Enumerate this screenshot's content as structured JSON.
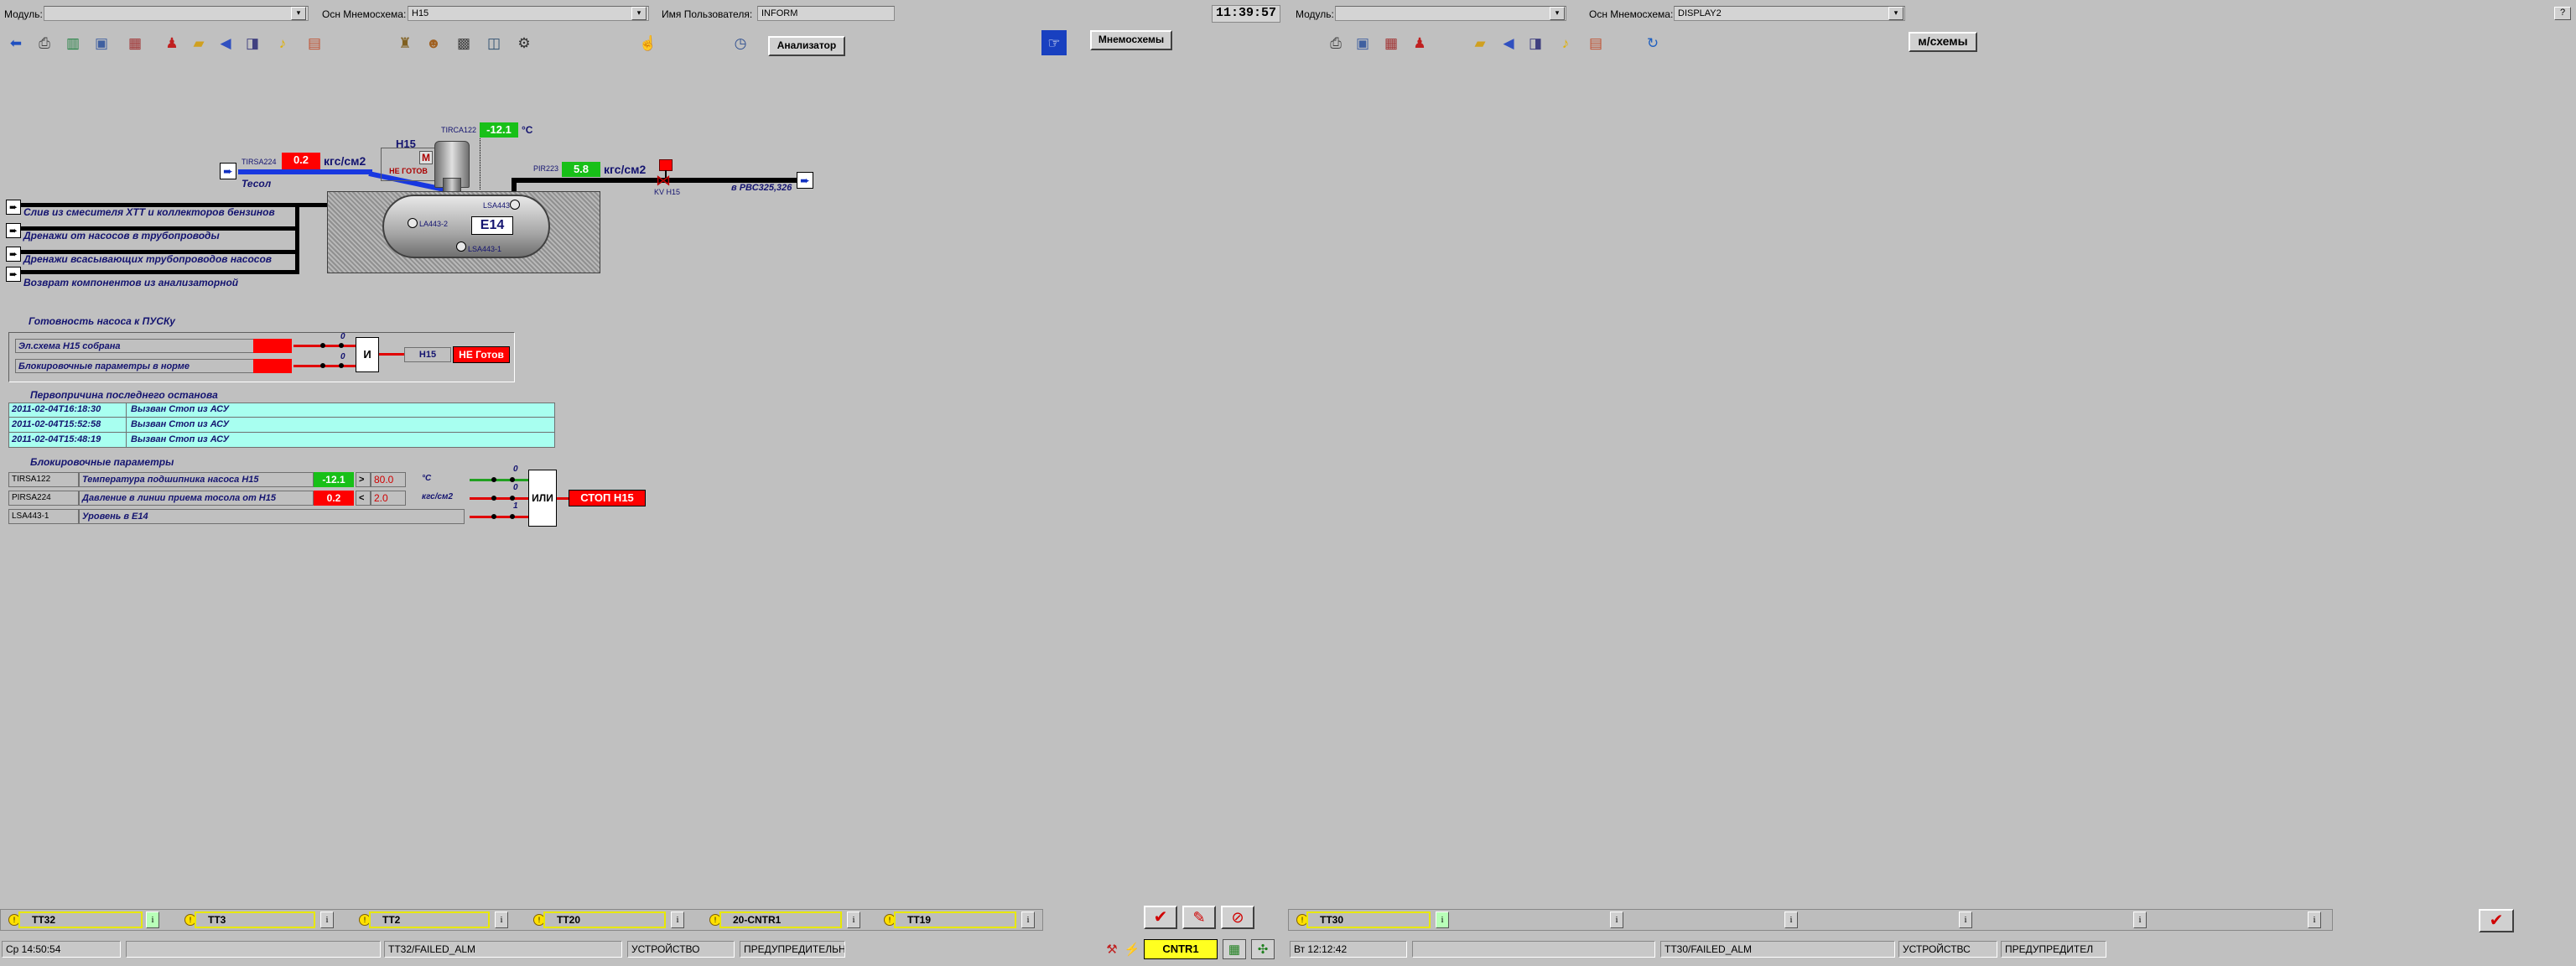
{
  "left_header": {
    "module_label": "Модуль:",
    "module_value": "",
    "mnemo_label": "Осн Мнемосхема:",
    "mnemo_value": "H15",
    "user_label": "Имя Пользователя:",
    "user_value": "INFORM"
  },
  "clock": "11:39:57",
  "right_header": {
    "module_label": "Модуль:",
    "module_value": "",
    "mnemo_label": "Осн Мнемосхема:",
    "mnemo_value": "DISPLAY2",
    "help": "?"
  },
  "buttons": {
    "analyzer": "Анализатор",
    "mnemoschemes": "Мнемосхемы",
    "mschemes_short": "м/схемы"
  },
  "schematic": {
    "tir_tag": "TIRSA224",
    "tir_value": "0.2",
    "tir_unit": "кгс/см2",
    "tesol": "Тесол",
    "pump_name": "H15",
    "pump_mode": "М",
    "pump_status": "НЕ ГОТОВ",
    "temp_tag": "TIRCA122",
    "temp_value": "-12.1",
    "temp_unit": "°C",
    "pir_tag": "PIR223",
    "pir_value": "5.8",
    "pir_unit": "кгс/см2",
    "kv_tag": "KV H15",
    "dest": "в РВС325,326",
    "tank_name": "E14",
    "lsa_2": "LA443-2",
    "lsa_4": "LSA443",
    "lsa_1": "LSA443-1",
    "inlets": [
      "Слив из смесителя ХТТ и коллекторов бензинов",
      "Дренажи от насосов в трубопроводы",
      "Дренажи всасывающих трубопроводов насосов",
      "Возврат компонентов из анализаторной"
    ]
  },
  "readiness": {
    "title": "Готовность насоса к ПУСКу",
    "rows": [
      "Эл.схема H15 собрана",
      "Блокировочные параметры в норме"
    ],
    "gate": "И",
    "zero": "0",
    "pump": "H15",
    "status": "НЕ Готов"
  },
  "first_cause": {
    "title": "Первопричина последнего останова",
    "rows": [
      {
        "time": "2011-02-04T16:18:30",
        "msg": "Вызван Стоп из АСУ"
      },
      {
        "time": "2011-02-04T15:52:58",
        "msg": "Вызван Стоп из АСУ"
      },
      {
        "time": "2011-02-04T15:48:19",
        "msg": "Вызван Стоп из АСУ"
      }
    ]
  },
  "interlocks": {
    "title": "Блокировочные параметры",
    "rows": [
      {
        "tag": "TIRSA122",
        "desc": "Температура подшипника насоса H15",
        "value": "-12.1",
        "cmp": ">",
        "limit": "80.0",
        "unit": "°C",
        "bit": "0"
      },
      {
        "tag": "PIRSA224",
        "desc": "Давление в линии приема тосола от H15",
        "value": "0.2",
        "cmp": "<",
        "limit": "2.0",
        "unit": "кгс/см2",
        "bit": "0"
      },
      {
        "tag": "LSA443-1",
        "desc": "Уровень в E14",
        "value": "",
        "cmp": "",
        "limit": "",
        "unit": "",
        "bit": "1"
      }
    ],
    "gate": "ИЛИ",
    "output": "СТОП H15"
  },
  "alarms_left": [
    {
      "label": "TT32",
      "info": "i"
    },
    {
      "label": "TT3",
      "info": "i"
    },
    {
      "label": "TT2",
      "info": "i"
    },
    {
      "label": "TT20",
      "info": "i"
    },
    {
      "label": "20-CNTR1",
      "info": "i"
    },
    {
      "label": "TT19",
      "info": "i"
    }
  ],
  "alarms_right": [
    {
      "label": "TT30",
      "info": "i"
    },
    {
      "label": "",
      "info": "i"
    },
    {
      "label": "",
      "info": "i"
    },
    {
      "label": "",
      "info": "i"
    },
    {
      "label": "",
      "info": "i"
    },
    {
      "label": "",
      "info": "i"
    }
  ],
  "status_left": {
    "time": "Ср 14:50:54",
    "blank": "",
    "alarm": "TT32/FAILED_ALM",
    "device": "УСТРОЙСТВО",
    "priority": "ПРЕДУПРЕДИТЕЛЬН"
  },
  "cntr": "CNTR1",
  "status_right": {
    "time": "Вт 12:12:42",
    "blank": "",
    "alarm": "TT30/FAILED_ALM",
    "device": "УСТРОЙСТВС",
    "priority": "ПРЕДУПРЕДИТЕЛ"
  },
  "colors": {
    "background": "#c0c0c0",
    "alarm_red": "#ff0000",
    "value_green": "#18c018",
    "cause_cyan": "#a8fff0",
    "text_navy": "#141470"
  }
}
